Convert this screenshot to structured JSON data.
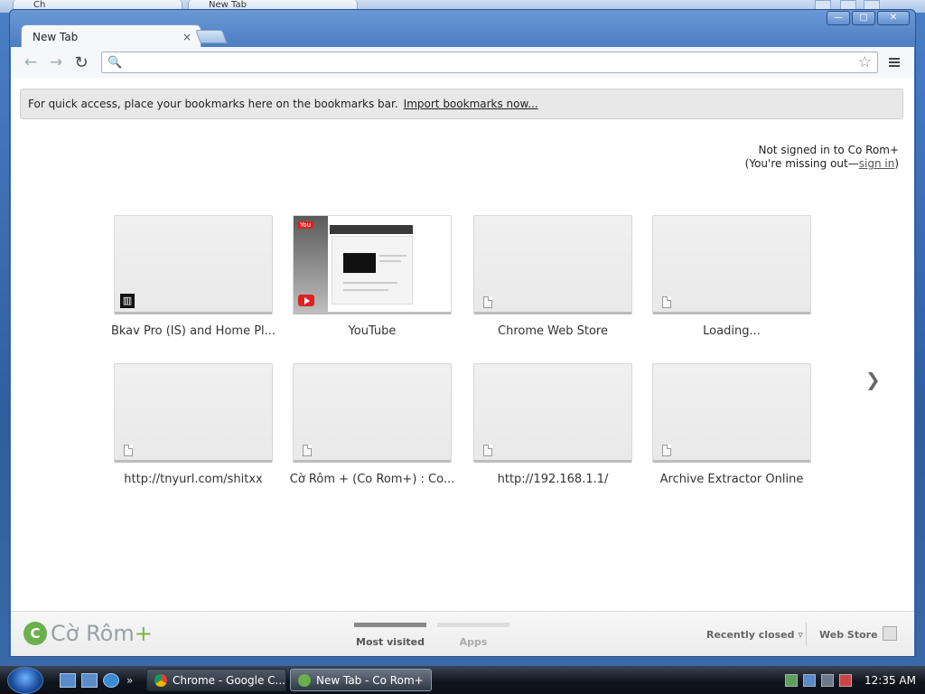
{
  "background_window": {
    "tabs": [
      "Ch",
      "New Tab"
    ]
  },
  "window": {
    "caption_buttons": [
      "minimize",
      "maximize",
      "close"
    ]
  },
  "tab": {
    "title": "New Tab",
    "close_glyph": "×"
  },
  "toolbar": {
    "back_glyph": "←",
    "forward_glyph": "→",
    "reload_glyph": "↻",
    "search_glyph": "🔍",
    "omnibox_value": "",
    "star_glyph": "☆"
  },
  "bookmark_bar": {
    "message": "For quick access, place your bookmarks here on the bookmarks bar.",
    "import_link": "Import bookmarks now..."
  },
  "signin": {
    "line1": "Not signed in to Co Rom+",
    "line2_prefix": "(You're missing out—",
    "link": "sign in",
    "line2_suffix": ")"
  },
  "tiles": [
    {
      "label": "Bkav Pro (IS) and Home Pl...",
      "icon": "bkav-icon"
    },
    {
      "label": "YouTube",
      "icon": "youtube-icon"
    },
    {
      "label": "Chrome Web Store",
      "icon": "page-icon"
    },
    {
      "label": "Loading...",
      "icon": "page-icon"
    },
    {
      "label": "http://tnyurl.com/shitxx",
      "icon": "page-icon"
    },
    {
      "label": "Cờ Rôm + (Co Rom+) : Co...",
      "icon": "page-icon"
    },
    {
      "label": "http://192.168.1.1/",
      "icon": "page-icon"
    },
    {
      "label": "Archive Extractor Online",
      "icon": "page-icon"
    }
  ],
  "next_glyph": "❯",
  "footer": {
    "logo_text": "Cờ Rôm",
    "logo_plus": "+",
    "logo_mark": "C",
    "pager": [
      "Most visited",
      "Apps"
    ],
    "recently_closed": "Recently closed ▿",
    "web_store": "Web Store"
  },
  "taskbar": {
    "more_glyph": "»",
    "buttons": [
      "Chrome - Google C...",
      "New Tab - Co Rom+"
    ],
    "clock": "12:35 AM"
  }
}
